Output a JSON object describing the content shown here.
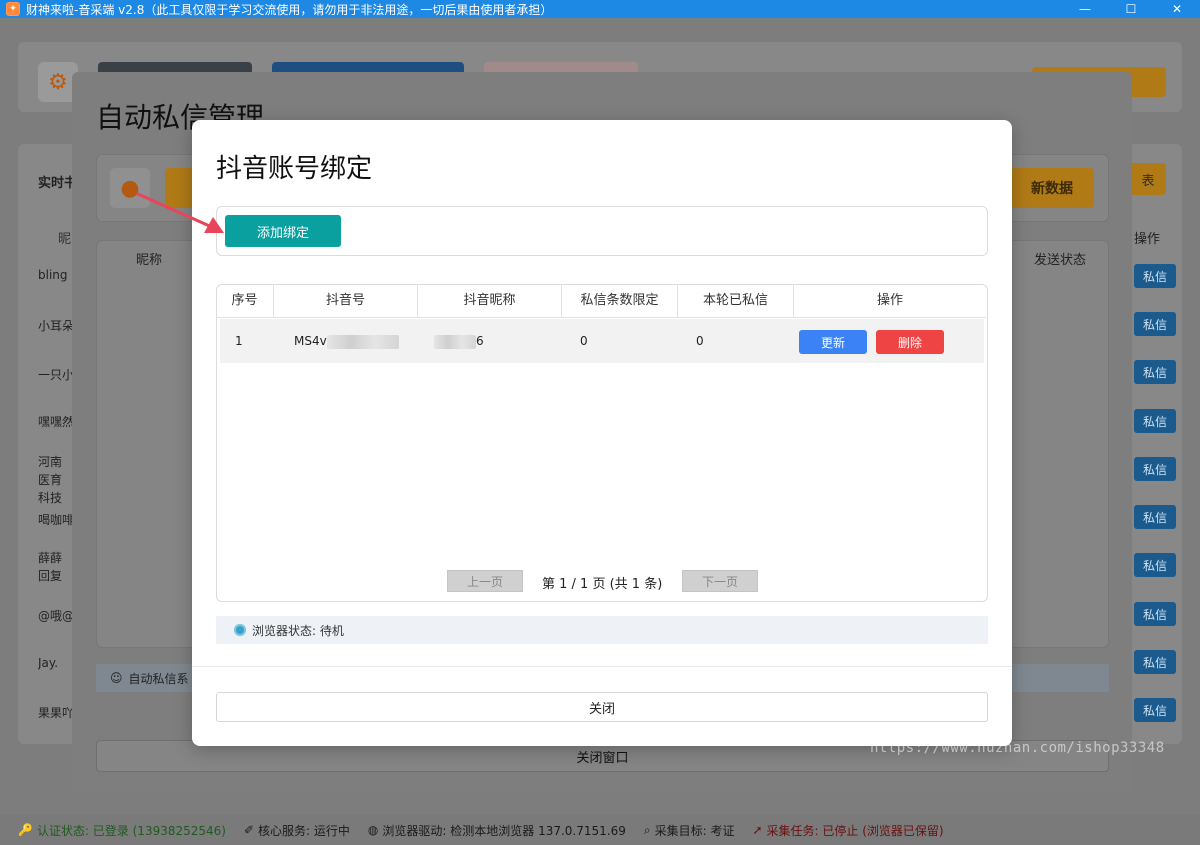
{
  "window": {
    "title": "财神来啦-音采端 v2.8（此工具仅限于学习交流使用，请勿用于非法用途，一切后果由使用者承担）",
    "minimize": "—",
    "maximize": "☐",
    "close": "✕"
  },
  "base": {
    "left_label": "实时书",
    "col_head": "昵",
    "list_items": [
      "bling",
      "小耳朵",
      "一只小",
      "嘿嘿然",
      "河南医育科技",
      "喝咖啡",
      "薛薛回复",
      "@哦@",
      "Jay.",
      "果果吖"
    ],
    "right_head": "操作",
    "right_btn_label": "私信",
    "right_orange_label": "表"
  },
  "mid_modal": {
    "title": "自动私信管理",
    "orange_right_label": "新数据",
    "th_left": "昵称",
    "th_right": "发送状态",
    "footer": "自动私信系",
    "close_label": "关闭窗口"
  },
  "modal": {
    "title": "抖音账号绑定",
    "add_button": "添加绑定",
    "table": {
      "headers": [
        "序号",
        "抖音号",
        "抖音昵称",
        "私信条数限定",
        "本轮已私信",
        "操作"
      ],
      "rows": [
        {
          "index": "1",
          "douyin_id": "MS4v",
          "nickname_tail": "6",
          "limit": "0",
          "sent": "0"
        }
      ],
      "update_label": "更新",
      "delete_label": "删除"
    },
    "pager": {
      "prev": "上一页",
      "next": "下一页",
      "info": "第 1 / 1 页 (共 1 条)"
    },
    "browser_status": "浏览器状态: 待机",
    "close_label": "关闭"
  },
  "statusbar": {
    "auth": "认证状态: 已登录 (13938252546)",
    "core": "核心服务: 运行中",
    "driver": "浏览器驱动: 检测本地浏览器 137.0.7151.69",
    "target": "采集目标: 考证",
    "task": "采集任务: 已停止 (浏览器已保留)"
  },
  "watermark": "https://www.huzhan.com/ishop33348",
  "colors": {
    "titlebar": "#1e88e5",
    "add_button": "#0aa0a0",
    "update_button": "#3b82f6",
    "delete_button": "#ef4444",
    "arrow": "#e8445a"
  }
}
